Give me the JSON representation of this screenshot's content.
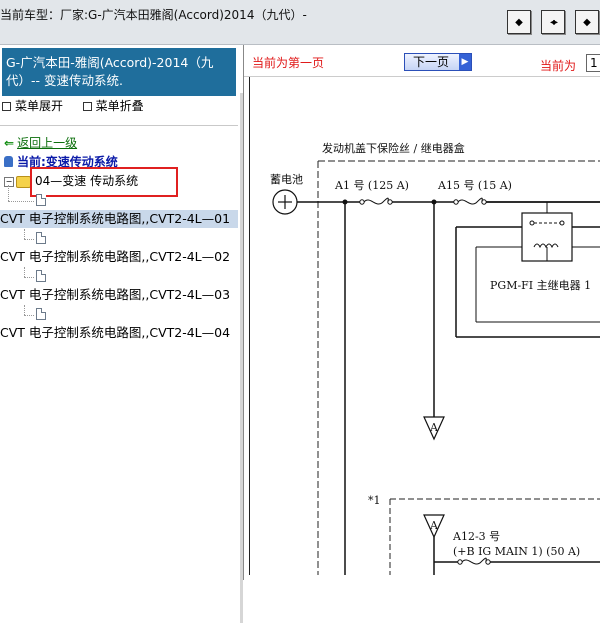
{
  "window": {
    "title": "当前车型：厂家:G-广汽本田雅阁(Accord)2014（九代）-",
    "buttons": [
      {
        "name": "prev-frame-button",
        "glyph": "◆"
      },
      {
        "name": "split-frame-button",
        "glyph": "◂▸"
      },
      {
        "name": "next-frame-button",
        "glyph": "◆"
      }
    ]
  },
  "left_panel": {
    "header_line1": "G-广汽本田-雅阁(Accord)-2014（九",
    "header_line2": "代）-- 变速传动系统.",
    "expand_label": "菜单展开",
    "collapse_label": "菜单折叠",
    "back_label": "返回上一级",
    "current_label": "当前:变速传动系统",
    "folder_label": "04—变速 传动系统",
    "items": [
      {
        "label": "CVT 电子控制系统电路图,,CVT2-4L—01",
        "selected": true
      },
      {
        "label": "CVT 电子控制系统电路图,,CVT2-4L—02",
        "selected": false
      },
      {
        "label": "CVT 电子控制系统电路图,,CVT2-4L—03",
        "selected": false
      },
      {
        "label": "CVT 电子控制系统电路图,,CVT2-4L—04",
        "selected": false
      }
    ]
  },
  "right_panel": {
    "first_page_notice": "当前为第一页",
    "next_button": "下一页",
    "current_page_label": "当前为",
    "current_page_value": "1"
  },
  "schematic": {
    "box_title": "发动机盖下保险丝 / 继电器盒",
    "battery_label": "蓄电池",
    "fuse_a1": "A1 号 (125 A)",
    "fuse_a15": "A15 号 (15 A)",
    "relay_label": "PGM-FI 主继电器 1",
    "connector_a": "A",
    "marker": "*1",
    "fuse_a12": "A12-3 号",
    "fuse_a12_desc": "(+B IG MAIN 1) (50 A)"
  },
  "colors": {
    "header_blue": "#1f6e9c",
    "selection": "#c9d8ea",
    "notice_red": "#e01818",
    "highlight_box": "#e02020"
  }
}
